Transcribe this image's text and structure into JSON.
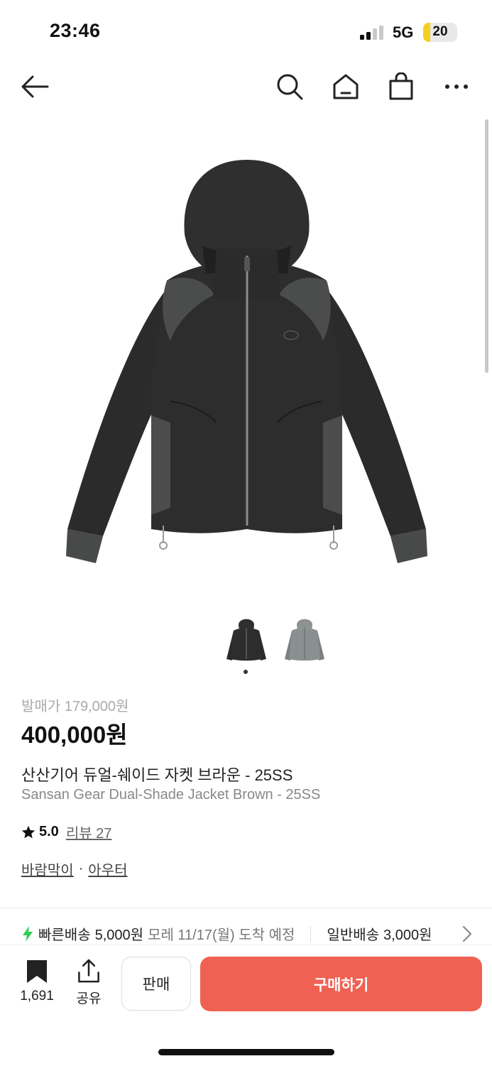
{
  "status_bar": {
    "time": "23:46",
    "network": "5G",
    "battery": "20",
    "battery_level_percent": 20
  },
  "nav": {
    "back_icon": "arrow-left-icon",
    "search_icon": "search-icon",
    "home_icon": "home-icon",
    "bag_icon": "shopping-bag-icon",
    "more_icon": "more-horizontal-icon"
  },
  "gallery": {
    "image_count": 2,
    "current_index": 1
  },
  "product": {
    "release_price": "발매가 179,000원",
    "price": "400,000원",
    "name_ko": "산산기어 듀얼-쉐이드 자켓 브라운 - 25SS",
    "name_en": "Sansan Gear Dual-Shade Jacket Brown - 25SS",
    "rating": "5.0",
    "review_link": "리뷰 27",
    "categories": [
      "바람막이",
      "아우터"
    ],
    "category_separator": "·"
  },
  "delivery": {
    "fast_label": "빠른배송",
    "fast_fee": "5,000원",
    "fast_eta": "모레 11/17(월) 도착 예정",
    "normal_label": "일반배송",
    "normal_fee": "3,000원"
  },
  "bottom_bar": {
    "bookmark_count": "1,691",
    "share_label": "공유",
    "sell_label": "판매",
    "buy_label": "구매하기"
  },
  "colors": {
    "accent": "#ef6253",
    "fast_delivery_green": "#2ecc52",
    "battery_yellow": "#f5cf1e"
  }
}
